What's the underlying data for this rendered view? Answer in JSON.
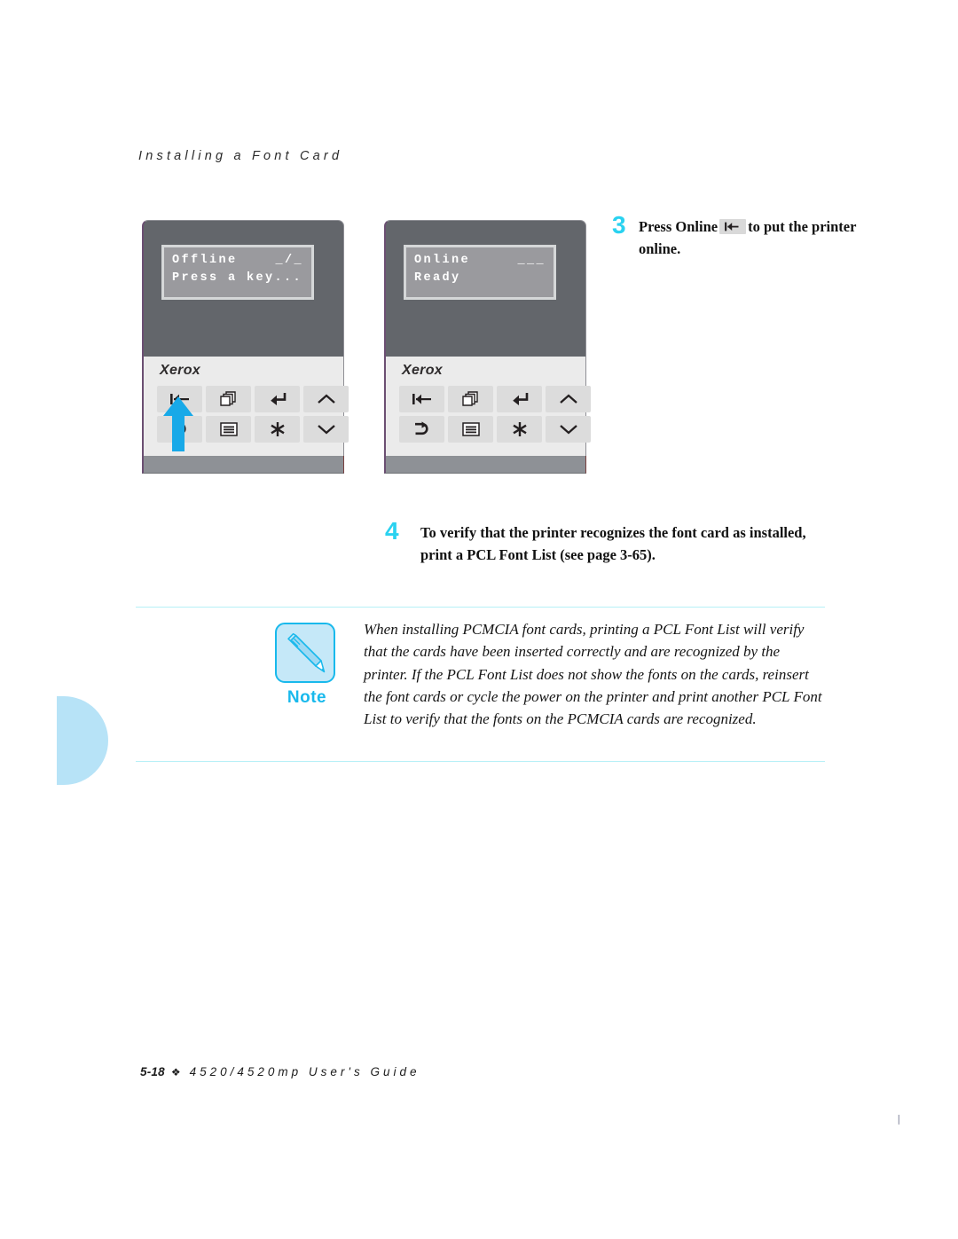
{
  "page": {
    "running_header": "Installing a Font Card",
    "footer_page_number": "5-18",
    "footer_separator": "❖",
    "footer_title": "4520/4520mp User's Guide",
    "corner_mark": "│"
  },
  "colors": {
    "accent_cyan": "#2ad2f0",
    "note_border": "#19b9ec",
    "note_fill": "#c5e8f8",
    "rule": "#b6f0f7",
    "margin_tab": "#b7e3f7",
    "panel_body": "#63666b",
    "lcd_face": "#9a9a9e",
    "key_face": "#dcdcdc"
  },
  "panels": [
    {
      "name": "offline-panel",
      "brand": "Xerox",
      "lcd": {
        "line1": "Offline",
        "line2": "Press a key...",
        "indicator": "_/_"
      },
      "keys": [
        {
          "name": "online-key",
          "icon": "arrow-to-bar-left-icon"
        },
        {
          "name": "form-feed-key",
          "icon": "stacked-pages-icon"
        },
        {
          "name": "enter-key",
          "icon": "return-arrow-icon"
        },
        {
          "name": "up-key",
          "icon": "chevron-up-icon"
        },
        {
          "name": "cancel-key",
          "icon": "curved-arrow-right-icon"
        },
        {
          "name": "menu-key",
          "icon": "menu-lines-icon"
        },
        {
          "name": "asterisk-key",
          "icon": "asterisk-icon"
        },
        {
          "name": "down-key",
          "icon": "chevron-down-icon"
        }
      ],
      "callout_arrow": "up-arrow-pointer"
    },
    {
      "name": "online-panel",
      "brand": "Xerox",
      "lcd": {
        "line1": "Online",
        "line2": "Ready",
        "indicator": "___"
      },
      "keys": [
        {
          "name": "online-key",
          "icon": "arrow-to-bar-left-icon"
        },
        {
          "name": "form-feed-key",
          "icon": "stacked-pages-icon"
        },
        {
          "name": "enter-key",
          "icon": "return-arrow-icon"
        },
        {
          "name": "up-key",
          "icon": "chevron-up-icon"
        },
        {
          "name": "cancel-key",
          "icon": "curved-arrow-right-icon"
        },
        {
          "name": "menu-key",
          "icon": "menu-lines-icon"
        },
        {
          "name": "asterisk-key",
          "icon": "asterisk-icon"
        },
        {
          "name": "down-key",
          "icon": "chevron-down-icon"
        }
      ],
      "callout_arrow": null
    }
  ],
  "steps": [
    {
      "number": "3",
      "text_before": "Press Online",
      "inline_key_icon": "arrow-to-bar-left-icon",
      "text_after": "to put the printer online."
    },
    {
      "number": "4",
      "text": "To verify that the printer recognizes the font card as installed, print a PCL Font List (see page 3-65)."
    }
  ],
  "note": {
    "label": "Note",
    "icon": "pencil-icon",
    "body": "When installing PCMCIA font cards, printing a PCL Font List will verify that the cards have been inserted correctly and are recognized by the printer. If the PCL Font List does not show the fonts on the cards, reinsert the font cards or cycle the power on the printer and print another PCL Font List to verify that the fonts on the PCMCIA cards are recognized."
  }
}
